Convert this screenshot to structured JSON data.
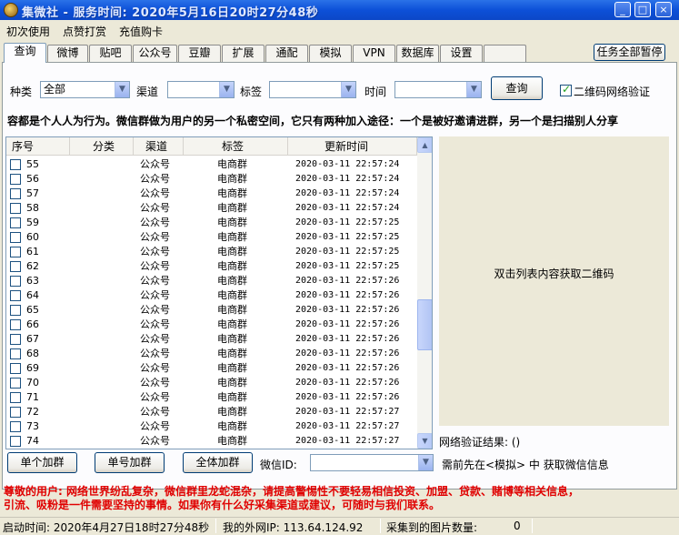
{
  "window": {
    "title": "集微社 - 服务时间: 2020年5月16日20时27分48秒",
    "buttons": {
      "minimize": "_",
      "restore": "□",
      "close": "×"
    }
  },
  "menu": [
    "初次使用",
    "点赞打赏",
    "充值购卡"
  ],
  "tabs": [
    "查询",
    "微博",
    "贴吧",
    "公众号",
    "豆瓣",
    "扩展",
    "通配",
    "模拟",
    "VPN",
    "数据库",
    "设置"
  ],
  "pause_all_label": "任务全部暂停",
  "filters": {
    "kind_label": "种类",
    "kind_value": "全部",
    "channel_label": "渠道",
    "channel_value": "",
    "tag_label": "标签",
    "tag_value": "",
    "time_label": "时间",
    "time_value": "",
    "query_button": "查询",
    "qr_verify_label": "二维码网络验证",
    "qr_verify_checked": true
  },
  "notice": "容都是个人人为行为。微信群做为用户的另一个私密空间，它只有两种加入途径：一个是被好邀请进群，另一个是扫描别人分享",
  "list": {
    "columns": [
      "序号",
      "分类",
      "渠道",
      "标签",
      "更新时间"
    ],
    "rows": [
      {
        "id": "55",
        "category": "",
        "channel": "公众号",
        "tag": "电商群",
        "time": "2020-03-11  22:57:24"
      },
      {
        "id": "56",
        "category": "",
        "channel": "公众号",
        "tag": "电商群",
        "time": "2020-03-11  22:57:24"
      },
      {
        "id": "57",
        "category": "",
        "channel": "公众号",
        "tag": "电商群",
        "time": "2020-03-11  22:57:24"
      },
      {
        "id": "58",
        "category": "",
        "channel": "公众号",
        "tag": "电商群",
        "time": "2020-03-11  22:57:24"
      },
      {
        "id": "59",
        "category": "",
        "channel": "公众号",
        "tag": "电商群",
        "time": "2020-03-11  22:57:25"
      },
      {
        "id": "60",
        "category": "",
        "channel": "公众号",
        "tag": "电商群",
        "time": "2020-03-11  22:57:25"
      },
      {
        "id": "61",
        "category": "",
        "channel": "公众号",
        "tag": "电商群",
        "time": "2020-03-11  22:57:25"
      },
      {
        "id": "62",
        "category": "",
        "channel": "公众号",
        "tag": "电商群",
        "time": "2020-03-11  22:57:25"
      },
      {
        "id": "63",
        "category": "",
        "channel": "公众号",
        "tag": "电商群",
        "time": "2020-03-11  22:57:26"
      },
      {
        "id": "64",
        "category": "",
        "channel": "公众号",
        "tag": "电商群",
        "time": "2020-03-11  22:57:26"
      },
      {
        "id": "65",
        "category": "",
        "channel": "公众号",
        "tag": "电商群",
        "time": "2020-03-11  22:57:26"
      },
      {
        "id": "66",
        "category": "",
        "channel": "公众号",
        "tag": "电商群",
        "time": "2020-03-11  22:57:26"
      },
      {
        "id": "67",
        "category": "",
        "channel": "公众号",
        "tag": "电商群",
        "time": "2020-03-11  22:57:26"
      },
      {
        "id": "68",
        "category": "",
        "channel": "公众号",
        "tag": "电商群",
        "time": "2020-03-11  22:57:26"
      },
      {
        "id": "69",
        "category": "",
        "channel": "公众号",
        "tag": "电商群",
        "time": "2020-03-11  22:57:26"
      },
      {
        "id": "70",
        "category": "",
        "channel": "公众号",
        "tag": "电商群",
        "time": "2020-03-11  22:57:26"
      },
      {
        "id": "71",
        "category": "",
        "channel": "公众号",
        "tag": "电商群",
        "time": "2020-03-11  22:57:26"
      },
      {
        "id": "72",
        "category": "",
        "channel": "公众号",
        "tag": "电商群",
        "time": "2020-03-11  22:57:27"
      },
      {
        "id": "73",
        "category": "",
        "channel": "公众号",
        "tag": "电商群",
        "time": "2020-03-11  22:57:27"
      },
      {
        "id": "74",
        "category": "",
        "channel": "公众号",
        "tag": "电商群",
        "time": "2020-03-11  22:57:27"
      }
    ]
  },
  "qr_hint": "双击列表内容获取二维码",
  "net_result": "网络验证结果: ()",
  "actions": {
    "single_join": "单个加群",
    "single_number_join": "单号加群",
    "all_join": "全体加群",
    "wechat_id_label": "微信ID:",
    "wechat_id_value": "",
    "hint": "需前先在<模拟> 中 获取微信信息"
  },
  "bottom_note_line1": "尊敬的用户: 网络世界纷乱复杂，微信群里龙蛇混杂，请提高警惕性不要轻易相信投资、加盟、贷款、赌博等相关信息，",
  "bottom_note_line2": "引流、吸粉是一件需要坚持的事情。如果你有什么好采集渠道或建议，可随时与我们联系。",
  "status": {
    "start_time": "启动时间: 2020年4月27日18时27分48秒",
    "ip": "我的外网IP: 113.64.124.92",
    "images_label": "采集到的图片数量:",
    "images_count": "0"
  }
}
